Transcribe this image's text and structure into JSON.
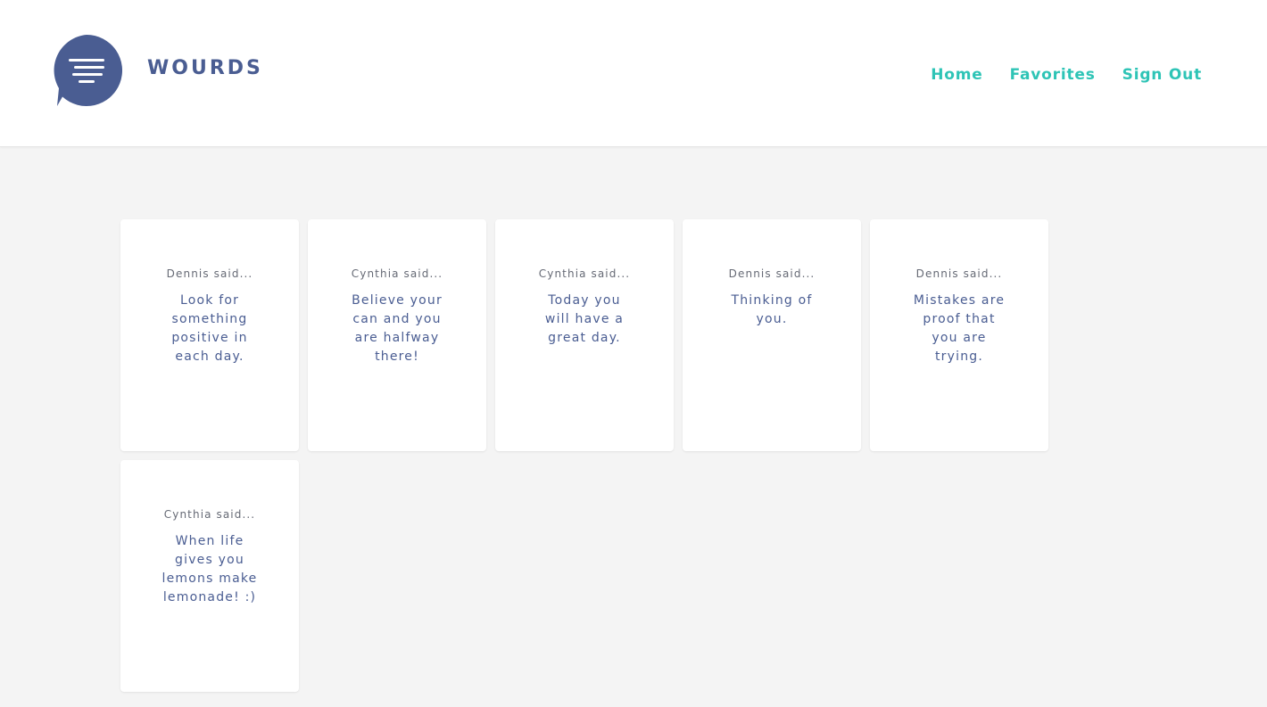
{
  "app": {
    "brand": "WOURDS",
    "logo_icon": "speech-bubble-menu-icon"
  },
  "colors": {
    "brand": "#4a5d92",
    "accent": "#2ec4b6",
    "background": "#f4f4f4",
    "card": "#ffffff"
  },
  "nav": {
    "home_label": "Home",
    "favorites_label": "Favorites",
    "signout_label": "Sign Out"
  },
  "cards": [
    {
      "author": "Dennis said...",
      "message": "Look for something positive in each day."
    },
    {
      "author": "Cynthia said...",
      "message": "Believe your can and you are halfway there!"
    },
    {
      "author": "Cynthia said...",
      "message": "Today you will have a great day."
    },
    {
      "author": "Dennis said...",
      "message": "Thinking of you."
    },
    {
      "author": "Dennis said...",
      "message": "Mistakes are proof that you are trying."
    },
    {
      "author": "Cynthia said...",
      "message": "When life gives you lemons make lemonade! :)"
    }
  ]
}
